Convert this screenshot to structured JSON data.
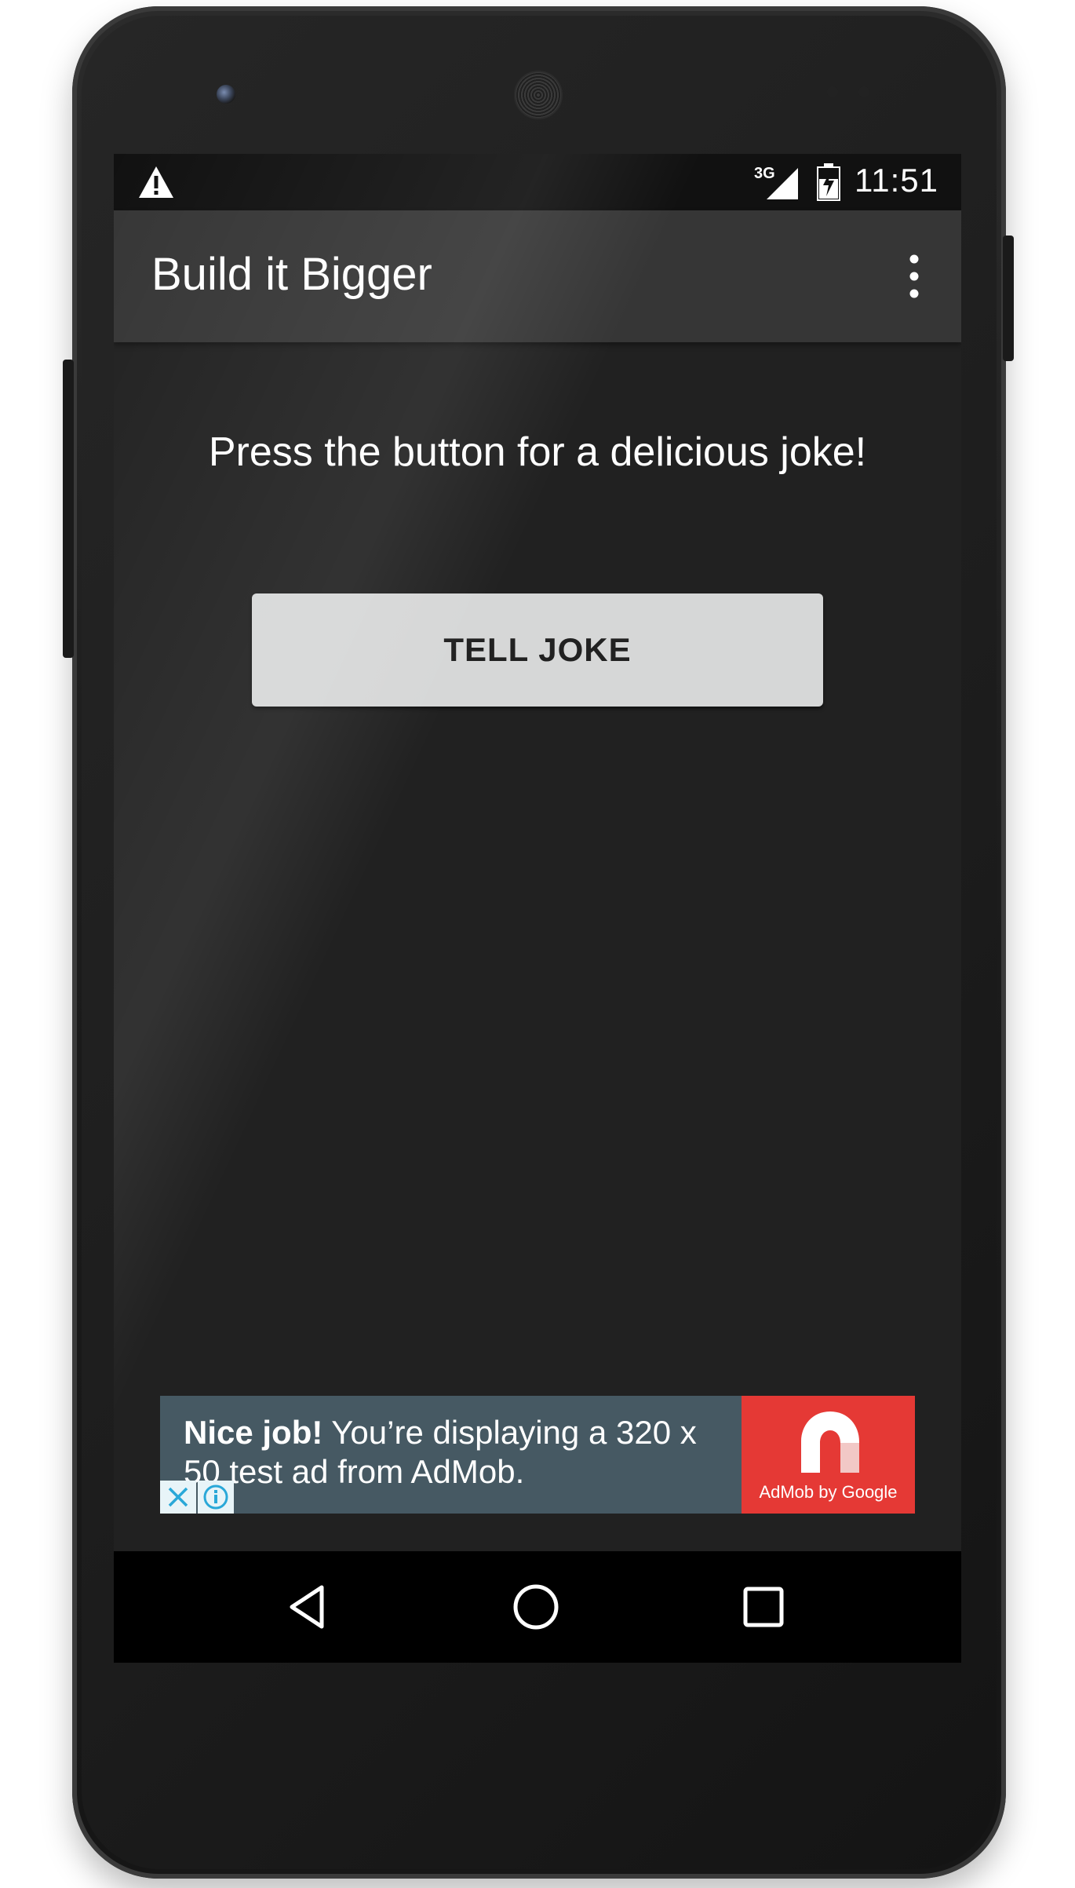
{
  "status_bar": {
    "network_type": "3G",
    "time": "11:51",
    "icons": [
      "warning-icon",
      "signal-icon",
      "battery-charging-icon"
    ]
  },
  "app_bar": {
    "title": "Build it Bigger",
    "menu_icon": "overflow-menu-icon"
  },
  "main": {
    "prompt": "Press the button for a delicious joke!",
    "button_label": "TELL JOKE"
  },
  "ad": {
    "headline_bold": "Nice job!",
    "headline_rest": " You’re displaying a 320 x 50 test ad from AdMob.",
    "brand": "AdMob by Google",
    "colors": {
      "background": "#465963",
      "brand_panel": "#e53935",
      "control_icons": "#2aa8d8"
    }
  },
  "nav_bar": {
    "icons": [
      "back-icon",
      "home-icon",
      "recents-icon"
    ]
  },
  "colors": {
    "screen_bg": "#212121",
    "app_bar": "#363636",
    "status_bar": "#111111",
    "button_bg": "#d6d7d7"
  }
}
